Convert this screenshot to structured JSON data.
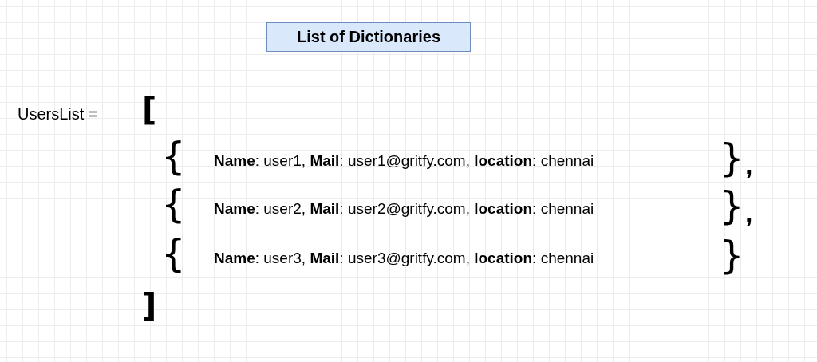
{
  "title": "List of Dictionaries",
  "variable": "UsersList =",
  "open_bracket": "[",
  "close_bracket": "]",
  "rows": [
    {
      "open": "{",
      "text": "**Name**: user1,  **Mail**: user1@gritfy.com, **location**: chennai",
      "close": "}",
      "separator": ","
    },
    {
      "open": "{",
      "text": "**Name**: user2,  **Mail**: user2@gritfy.com, **location**: chennai",
      "close": "}",
      "separator": ","
    },
    {
      "open": "{",
      "text": "**Name**: user3,  **Mail**: user3@gritfy.com, **location**: chennai",
      "close": "}"
    }
  ]
}
